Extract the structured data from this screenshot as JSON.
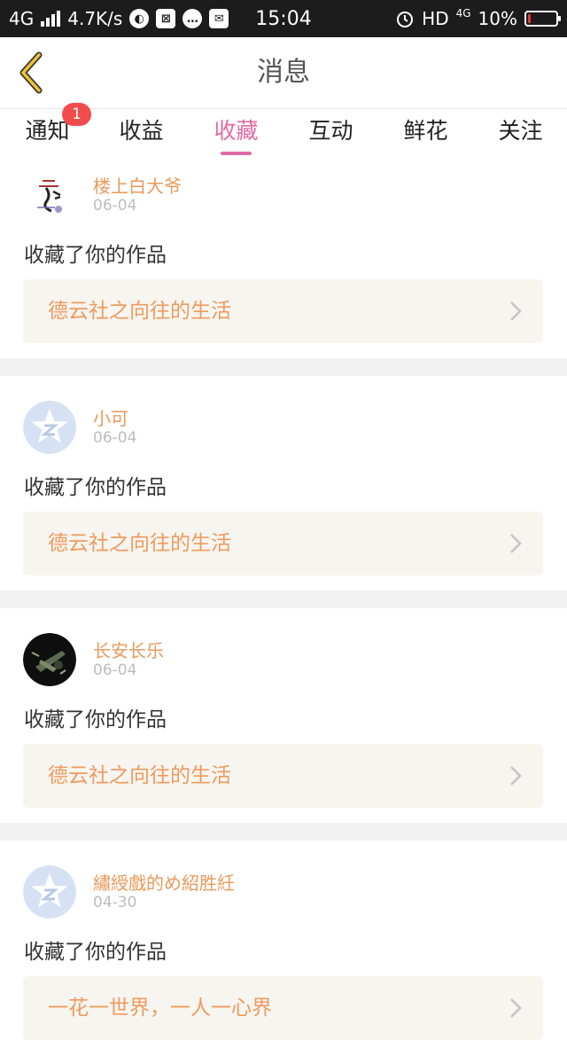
{
  "status_bar": {
    "network": "4G",
    "speed": "4.7K/s",
    "time": "15:04",
    "hd": "HD",
    "net2": "4G",
    "battery": "10%",
    "battery_level": 0.1
  },
  "header": {
    "title": "消息"
  },
  "tabs": [
    {
      "label": "通知",
      "badge": "1"
    },
    {
      "label": "收益"
    },
    {
      "label": "收藏",
      "active": true
    },
    {
      "label": "互动"
    },
    {
      "label": "鲜花"
    },
    {
      "label": "关注"
    }
  ],
  "messages": [
    {
      "user": "楼上白大爷",
      "date": "06-04",
      "action": "收藏了你的作品",
      "work": "德云社之向往的生活",
      "avatar": "calligraphy-avatar"
    },
    {
      "user": "小可",
      "date": "06-04",
      "action": "收藏了你的作品",
      "work": "德云社之向往的生活",
      "avatar": "default-z-avatar"
    },
    {
      "user": "长安长乐",
      "date": "06-04",
      "action": "收藏了你的作品",
      "work": "德云社之向往的生活",
      "avatar": "dark-photo-avatar"
    },
    {
      "user": "繡綬戲的め紹胜紝",
      "date": "04-30",
      "action": "收藏了你的作品",
      "work": "一花一世界，一人一心界",
      "avatar": "default-z-avatar"
    }
  ],
  "colors": {
    "accent": "#e26aa4",
    "username": "#e89a5b",
    "work_title": "#ef9a5f",
    "badge": "#f24b4b"
  }
}
